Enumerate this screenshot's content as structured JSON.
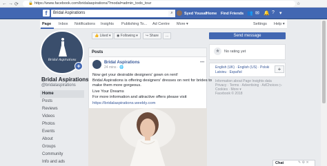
{
  "browser": {
    "url": "https://www.facebook.com/bridalaspirations/?modal=admin_todo_tour"
  },
  "topbar": {
    "search_value": "Bridal Aspirations",
    "user_name": "Syed Yousaf",
    "home": "Home",
    "find_friends": "Find Friends"
  },
  "page_nav": {
    "items": [
      "Page",
      "Inbox",
      "Notifications",
      "Insights",
      "Publishing To...",
      "Ad Centre",
      "More"
    ],
    "settings": "Settings",
    "help": "Help"
  },
  "page": {
    "logo_text": "Bridal Aspirations",
    "name": "Bridal Aspirations",
    "handle": "@bridalaspirations"
  },
  "left_nav": [
    "Home",
    "Posts",
    "Reviews",
    "Videos",
    "Photos",
    "Events",
    "About",
    "Groups",
    "Community",
    "Info and ads"
  ],
  "actions": {
    "liked": "Liked",
    "following": "Following",
    "share": "Share",
    "more": "...",
    "send_message": "Send message"
  },
  "posts": {
    "header": "Posts",
    "author": "Bridal Aspirations",
    "time": "24 mins",
    "lines": [
      "Now get your desirable designers' gown on rent!",
      "Bridal Aspirations is offering designers' dresses on rent for brides to",
      "make them more gorgeous.",
      "Live Your Dreams",
      "For more information and attractive offers please visit"
    ],
    "link": "https://bridalaspirations.weebly.com"
  },
  "rating": {
    "text": "No rating yet"
  },
  "languages": {
    "line1": "English (UK) · English (US) · Polski",
    "line2": "Latvieu · Español"
  },
  "footer": {
    "lines": [
      "Information about Page Insights data",
      "Privacy · Terms · Advertising · AdChoices ▷",
      "Cookies · More ▾",
      "Facebook © 2018"
    ]
  },
  "chat": {
    "label": "Chat"
  }
}
